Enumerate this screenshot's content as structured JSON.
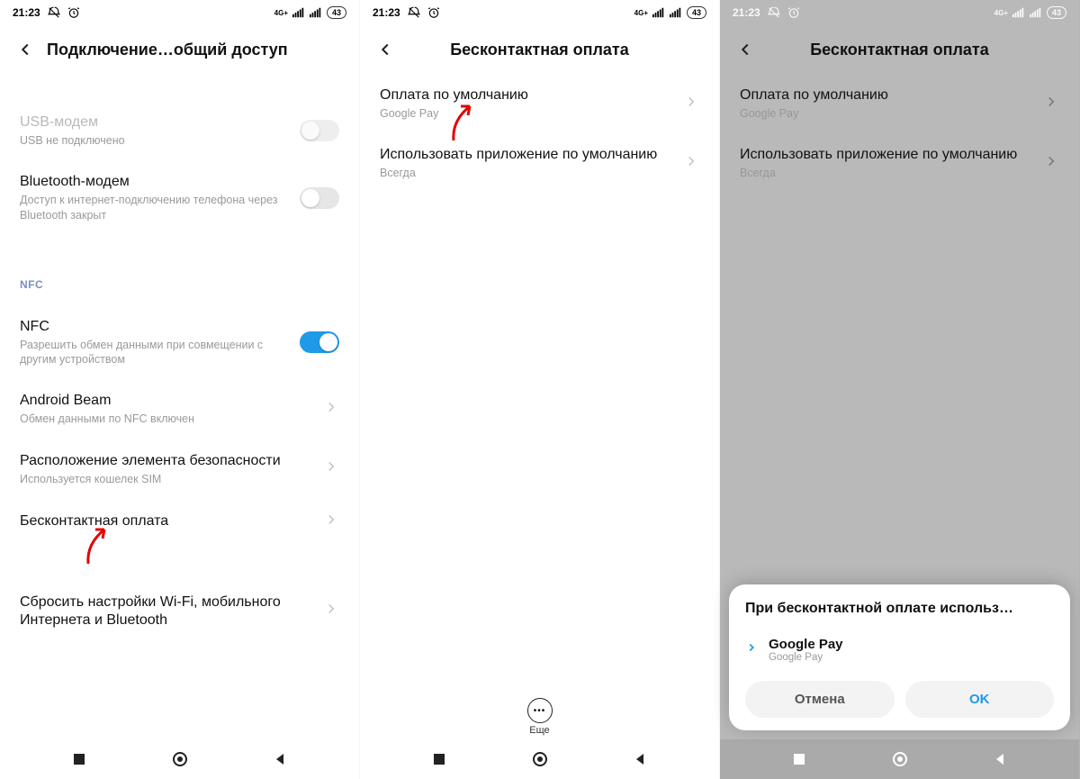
{
  "status": {
    "time": "21:23",
    "net": "4G+",
    "battery": "43"
  },
  "screen1": {
    "title": "Подключение…общий доступ",
    "usb": {
      "label": "USB-модем",
      "sub": "USB не подключено"
    },
    "bt": {
      "label": "Bluetooth-модем",
      "sub": "Доступ к интернет-подключению телефона через Bluetooth закрыт"
    },
    "section_nfc": "NFC",
    "nfc": {
      "label": "NFC",
      "sub": "Разрешить обмен данными при совмещении с другим устройством"
    },
    "beam": {
      "label": "Android Beam",
      "sub": "Обмен данными по NFC включен"
    },
    "sec": {
      "label": "Расположение элемента безопасности",
      "sub": "Используется кошелек SIM"
    },
    "contactless": {
      "label": "Бесконтактная оплата"
    },
    "reset": {
      "label": "Сбросить настройки Wi-Fi, мобильного Интернета и Bluetooth"
    }
  },
  "screen2": {
    "title": "Бесконтактная оплата",
    "default_pay": {
      "label": "Оплата по умолчанию",
      "sub": "Google Pay"
    },
    "use_app": {
      "label": "Использовать приложение по умолчанию",
      "sub": "Всегда"
    },
    "more": "Еще"
  },
  "screen3": {
    "title": "Бесконтактная оплата",
    "default_pay": {
      "label": "Оплата по умолчанию",
      "sub": "Google Pay"
    },
    "use_app": {
      "label": "Использовать приложение по умолчанию",
      "sub": "Всегда"
    },
    "sheet": {
      "title": "При бесконтактной оплате использ…",
      "item_label": "Google Pay",
      "item_sub": "Google Pay",
      "cancel": "Отмена",
      "ok": "OK"
    }
  }
}
